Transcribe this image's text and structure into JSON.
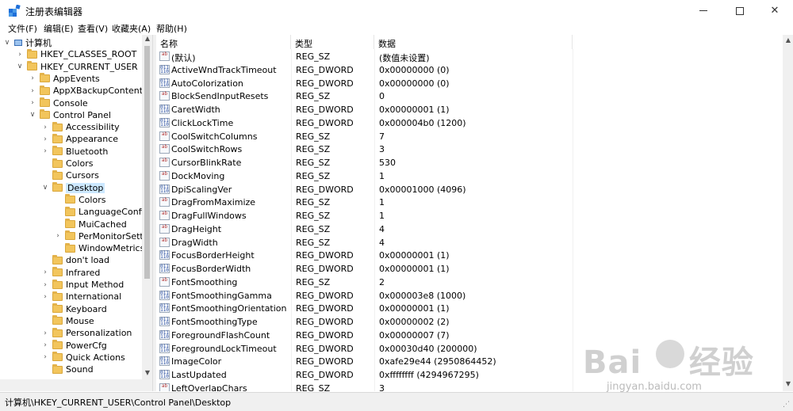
{
  "window": {
    "title": "注册表编辑器",
    "minimize": "—",
    "maximize": "☐",
    "close": "✕"
  },
  "menu": [
    "文件(F)",
    "编辑(E)",
    "查看(V)",
    "收藏夹(A)",
    "帮助(H)"
  ],
  "tree": [
    {
      "label": "计算机",
      "level": 0,
      "expander": "∨",
      "icon": "computer-icon"
    },
    {
      "label": "HKEY_CLASSES_ROOT",
      "level": 1,
      "expander": "›"
    },
    {
      "label": "HKEY_CURRENT_USER",
      "level": 1,
      "expander": "∨"
    },
    {
      "label": "AppEvents",
      "level": 2,
      "expander": "›"
    },
    {
      "label": "AppXBackupContentType",
      "level": 2,
      "expander": "›"
    },
    {
      "label": "Console",
      "level": 2,
      "expander": "›"
    },
    {
      "label": "Control Panel",
      "level": 2,
      "expander": "∨"
    },
    {
      "label": "Accessibility",
      "level": 3,
      "expander": "›"
    },
    {
      "label": "Appearance",
      "level": 3,
      "expander": "›"
    },
    {
      "label": "Bluetooth",
      "level": 3,
      "expander": "›"
    },
    {
      "label": "Colors",
      "level": 3,
      "expander": ""
    },
    {
      "label": "Cursors",
      "level": 3,
      "expander": ""
    },
    {
      "label": "Desktop",
      "level": 3,
      "expander": "∨",
      "selected": true
    },
    {
      "label": "Colors",
      "level": 4,
      "expander": ""
    },
    {
      "label": "LanguageConfigura",
      "level": 4,
      "expander": ""
    },
    {
      "label": "MuiCached",
      "level": 4,
      "expander": ""
    },
    {
      "label": "PerMonitorSettings",
      "level": 4,
      "expander": "›"
    },
    {
      "label": "WindowMetrics",
      "level": 4,
      "expander": ""
    },
    {
      "label": "don't load",
      "level": 3,
      "expander": ""
    },
    {
      "label": "Infrared",
      "level": 3,
      "expander": "›"
    },
    {
      "label": "Input Method",
      "level": 3,
      "expander": "›"
    },
    {
      "label": "International",
      "level": 3,
      "expander": "›"
    },
    {
      "label": "Keyboard",
      "level": 3,
      "expander": ""
    },
    {
      "label": "Mouse",
      "level": 3,
      "expander": ""
    },
    {
      "label": "Personalization",
      "level": 3,
      "expander": "›"
    },
    {
      "label": "PowerCfg",
      "level": 3,
      "expander": "›"
    },
    {
      "label": "Quick Actions",
      "level": 3,
      "expander": "›"
    },
    {
      "label": "Sound",
      "level": 3,
      "expander": ""
    }
  ],
  "columns": {
    "name": "名称",
    "type": "类型",
    "data": "数据"
  },
  "values": [
    {
      "name": "(默认)",
      "type": "REG_SZ",
      "data": "(数值未设置)",
      "icon": "string-value-icon"
    },
    {
      "name": "ActiveWndTrackTimeout",
      "type": "REG_DWORD",
      "data": "0x00000000 (0)",
      "icon": "binary-value-icon"
    },
    {
      "name": "AutoColorization",
      "type": "REG_DWORD",
      "data": "0x00000000 (0)",
      "icon": "binary-value-icon"
    },
    {
      "name": "BlockSendInputResets",
      "type": "REG_SZ",
      "data": "0",
      "icon": "string-value-icon"
    },
    {
      "name": "CaretWidth",
      "type": "REG_DWORD",
      "data": "0x00000001 (1)",
      "icon": "binary-value-icon"
    },
    {
      "name": "ClickLockTime",
      "type": "REG_DWORD",
      "data": "0x000004b0 (1200)",
      "icon": "binary-value-icon"
    },
    {
      "name": "CoolSwitchColumns",
      "type": "REG_SZ",
      "data": "7",
      "icon": "string-value-icon"
    },
    {
      "name": "CoolSwitchRows",
      "type": "REG_SZ",
      "data": "3",
      "icon": "string-value-icon"
    },
    {
      "name": "CursorBlinkRate",
      "type": "REG_SZ",
      "data": "530",
      "icon": "string-value-icon"
    },
    {
      "name": "DockMoving",
      "type": "REG_SZ",
      "data": "1",
      "icon": "string-value-icon"
    },
    {
      "name": "DpiScalingVer",
      "type": "REG_DWORD",
      "data": "0x00001000 (4096)",
      "icon": "binary-value-icon"
    },
    {
      "name": "DragFromMaximize",
      "type": "REG_SZ",
      "data": "1",
      "icon": "string-value-icon"
    },
    {
      "name": "DragFullWindows",
      "type": "REG_SZ",
      "data": "1",
      "icon": "string-value-icon"
    },
    {
      "name": "DragHeight",
      "type": "REG_SZ",
      "data": "4",
      "icon": "string-value-icon"
    },
    {
      "name": "DragWidth",
      "type": "REG_SZ",
      "data": "4",
      "icon": "string-value-icon"
    },
    {
      "name": "FocusBorderHeight",
      "type": "REG_DWORD",
      "data": "0x00000001 (1)",
      "icon": "binary-value-icon"
    },
    {
      "name": "FocusBorderWidth",
      "type": "REG_DWORD",
      "data": "0x00000001 (1)",
      "icon": "binary-value-icon"
    },
    {
      "name": "FontSmoothing",
      "type": "REG_SZ",
      "data": "2",
      "icon": "string-value-icon"
    },
    {
      "name": "FontSmoothingGamma",
      "type": "REG_DWORD",
      "data": "0x000003e8 (1000)",
      "icon": "binary-value-icon"
    },
    {
      "name": "FontSmoothingOrientation",
      "type": "REG_DWORD",
      "data": "0x00000001 (1)",
      "icon": "binary-value-icon"
    },
    {
      "name": "FontSmoothingType",
      "type": "REG_DWORD",
      "data": "0x00000002 (2)",
      "icon": "binary-value-icon"
    },
    {
      "name": "ForegroundFlashCount",
      "type": "REG_DWORD",
      "data": "0x00000007 (7)",
      "icon": "binary-value-icon"
    },
    {
      "name": "ForegroundLockTimeout",
      "type": "REG_DWORD",
      "data": "0x00030d40 (200000)",
      "icon": "binary-value-icon"
    },
    {
      "name": "ImageColor",
      "type": "REG_DWORD",
      "data": "0xafe29e44 (2950864452)",
      "icon": "binary-value-icon"
    },
    {
      "name": "LastUpdated",
      "type": "REG_DWORD",
      "data": "0xffffffff (4294967295)",
      "icon": "binary-value-icon"
    },
    {
      "name": "LeftOverlapChars",
      "type": "REG_SZ",
      "data": "3",
      "icon": "string-value-icon"
    }
  ],
  "statusbar": {
    "path": "计算机\\HKEY_CURRENT_USER\\Control Panel\\Desktop"
  },
  "watermark": {
    "logo": "Bai 经验",
    "url": "jingyan.baidu.com"
  }
}
